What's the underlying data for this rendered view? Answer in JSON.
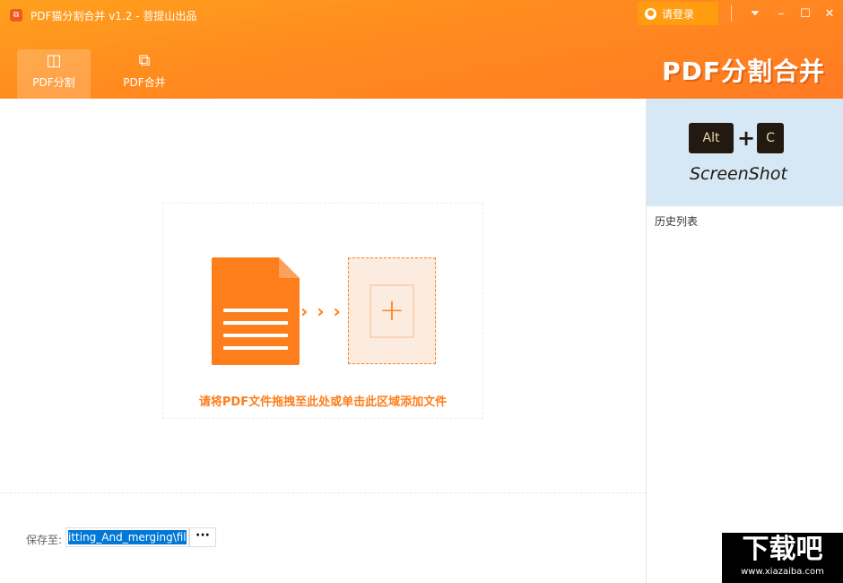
{
  "window": {
    "title": "PDF猫分割合并 v1.2 - 菩提山出品",
    "login": "请登录",
    "brand": "PDF分割合并"
  },
  "tabs": [
    {
      "label": "PDF分割",
      "icon": "split-icon",
      "active": true
    },
    {
      "label": "PDF合并",
      "icon": "merge-icon",
      "active": false
    }
  ],
  "dropzone": {
    "hint": "请将PDF文件拖拽至此处或单击此区域添加文件"
  },
  "save": {
    "label": "保存至:",
    "value": "itting_And_merging\\file",
    "browse": "···"
  },
  "sidebar": {
    "banner": {
      "key1": "Alt",
      "plus": "+",
      "key2": "C",
      "caption": "ScreenShot"
    },
    "history_title": "历史列表"
  },
  "watermark": {
    "logo": "下载吧",
    "url": "www.xiazaiba.com"
  },
  "colors": {
    "accent": "#fd7e1b",
    "header": "#ff8c1f"
  }
}
